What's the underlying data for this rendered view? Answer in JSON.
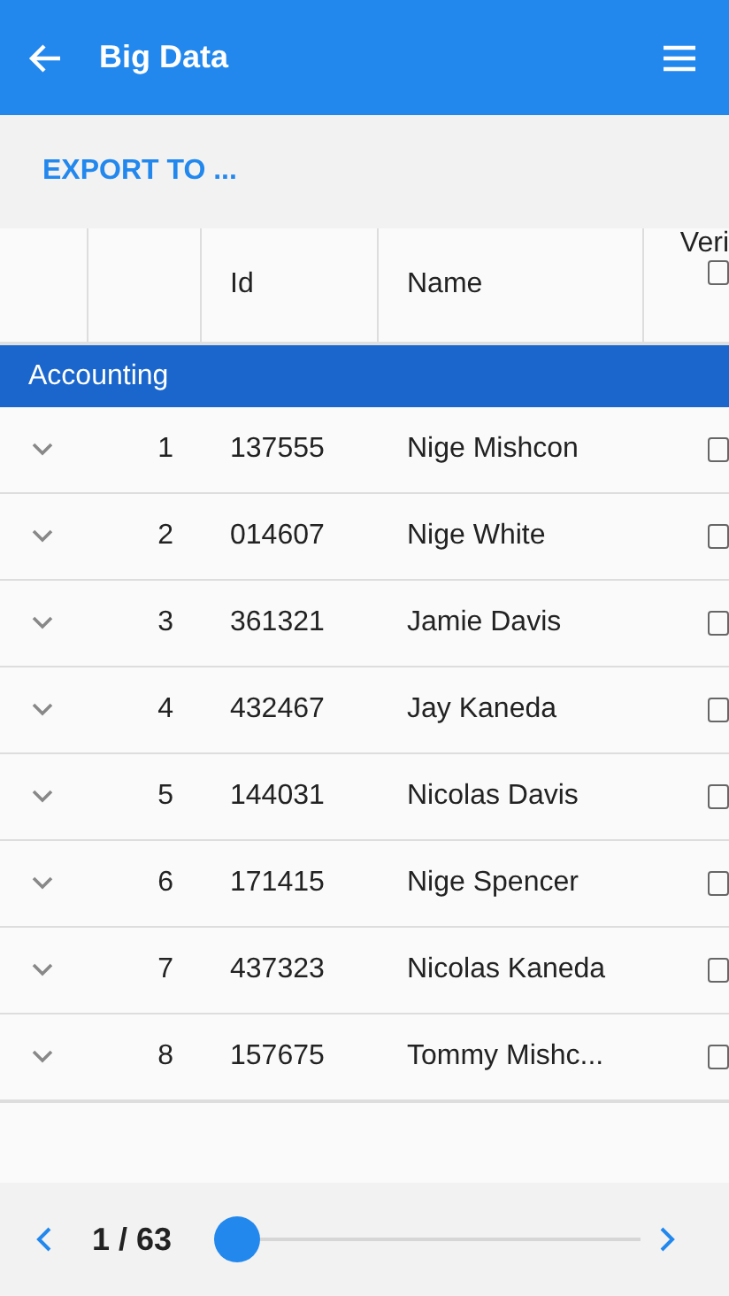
{
  "app_bar": {
    "title": "Big Data"
  },
  "toolbar": {
    "export_button": "EXPORT TO ..."
  },
  "table": {
    "columns": [
      {
        "kind": "blank"
      },
      {
        "kind": "blank"
      },
      {
        "kind": "text",
        "label": "Id"
      },
      {
        "kind": "text",
        "label": "Name"
      },
      {
        "kind": "checkbox",
        "label": "Veri",
        "checked": false
      }
    ],
    "group": {
      "label": "Accounting"
    },
    "rows": [
      {
        "number": "1",
        "id": "137555",
        "name": "Nige Mishcon",
        "expanded": false,
        "checked": false
      },
      {
        "number": "2",
        "id": "014607",
        "name": "Nige White",
        "expanded": false,
        "checked": false
      },
      {
        "number": "3",
        "id": "361321",
        "name": "Jamie Davis",
        "expanded": false,
        "checked": false
      },
      {
        "number": "4",
        "id": "432467",
        "name": "Jay Kaneda",
        "expanded": false,
        "checked": false
      },
      {
        "number": "5",
        "id": "144031",
        "name": "Nicolas Davis",
        "expanded": false,
        "checked": false
      },
      {
        "number": "6",
        "id": "171415",
        "name": "Nige Spencer",
        "expanded": false,
        "checked": false
      },
      {
        "number": "7",
        "id": "437323",
        "name": "Nicolas Kaneda",
        "expanded": false,
        "checked": false
      },
      {
        "number": "8",
        "id": "157675",
        "name": "Tommy Mishc...",
        "expanded": false,
        "checked": false
      }
    ]
  },
  "pager": {
    "label": "1 / 63",
    "level": 0
  }
}
